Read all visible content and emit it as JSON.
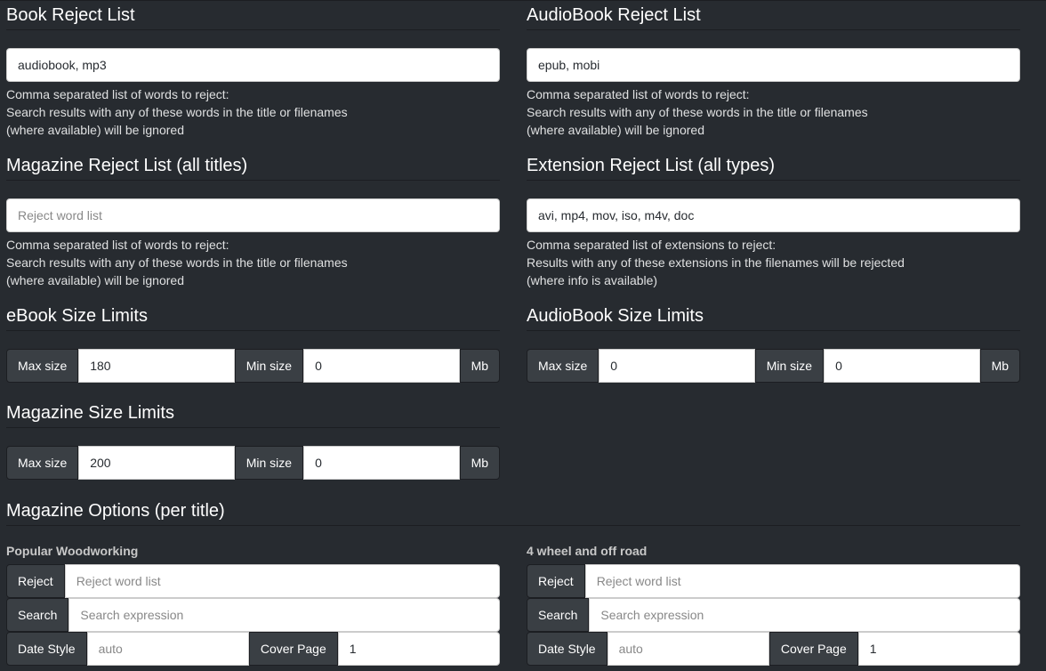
{
  "book_reject": {
    "title": "Book Reject List",
    "value": "audiobook, mp3",
    "help": [
      "Comma separated list of words to reject:",
      "Search results with any of these words in the title or filenames",
      "(where available) will be ignored"
    ]
  },
  "audiobook_reject": {
    "title": "AudioBook Reject List",
    "value": "epub, mobi",
    "help": [
      "Comma separated list of words to reject:",
      "Search results with any of these words in the title or filenames",
      "(where available) will be ignored"
    ]
  },
  "magazine_reject": {
    "title": "Magazine Reject List (all titles)",
    "placeholder": "Reject word list",
    "help": [
      "Comma separated list of words to reject:",
      "Search results with any of these words in the title or filenames",
      "(where available) will be ignored"
    ]
  },
  "extension_reject": {
    "title": "Extension Reject List (all types)",
    "value": "avi, mp4, mov, iso, m4v, doc",
    "help": [
      "Comma separated list of extensions to reject:",
      "Results with any of these extensions in the filenames will be rejected",
      "(where info is available)"
    ]
  },
  "ebook_size": {
    "title": "eBook Size Limits",
    "max_label": "Max size",
    "max": "180",
    "min_label": "Min size",
    "min": "0",
    "unit": "Mb"
  },
  "audiobook_size": {
    "title": "AudioBook Size Limits",
    "max_label": "Max size",
    "max": "0",
    "min_label": "Min size",
    "min": "0",
    "unit": "Mb"
  },
  "magazine_size": {
    "title": "Magazine Size Limits",
    "max_label": "Max size",
    "max": "200",
    "min_label": "Min size",
    "min": "0",
    "unit": "Mb"
  },
  "magazine_options": {
    "title": "Magazine Options (per title)",
    "titles": [
      {
        "name": "Popular Woodworking",
        "reject_label": "Reject",
        "reject_placeholder": "Reject word list",
        "search_label": "Search",
        "search_placeholder": "Search expression",
        "date_label": "Date Style",
        "date_placeholder": "auto",
        "cover_label": "Cover Page",
        "cover": "1"
      },
      {
        "name": "4 wheel and off road",
        "reject_label": "Reject",
        "reject_placeholder": "Reject word list",
        "search_label": "Search",
        "search_placeholder": "Search expression",
        "date_label": "Date Style",
        "date_placeholder": "auto",
        "cover_label": "Cover Page",
        "cover": "1"
      }
    ]
  }
}
